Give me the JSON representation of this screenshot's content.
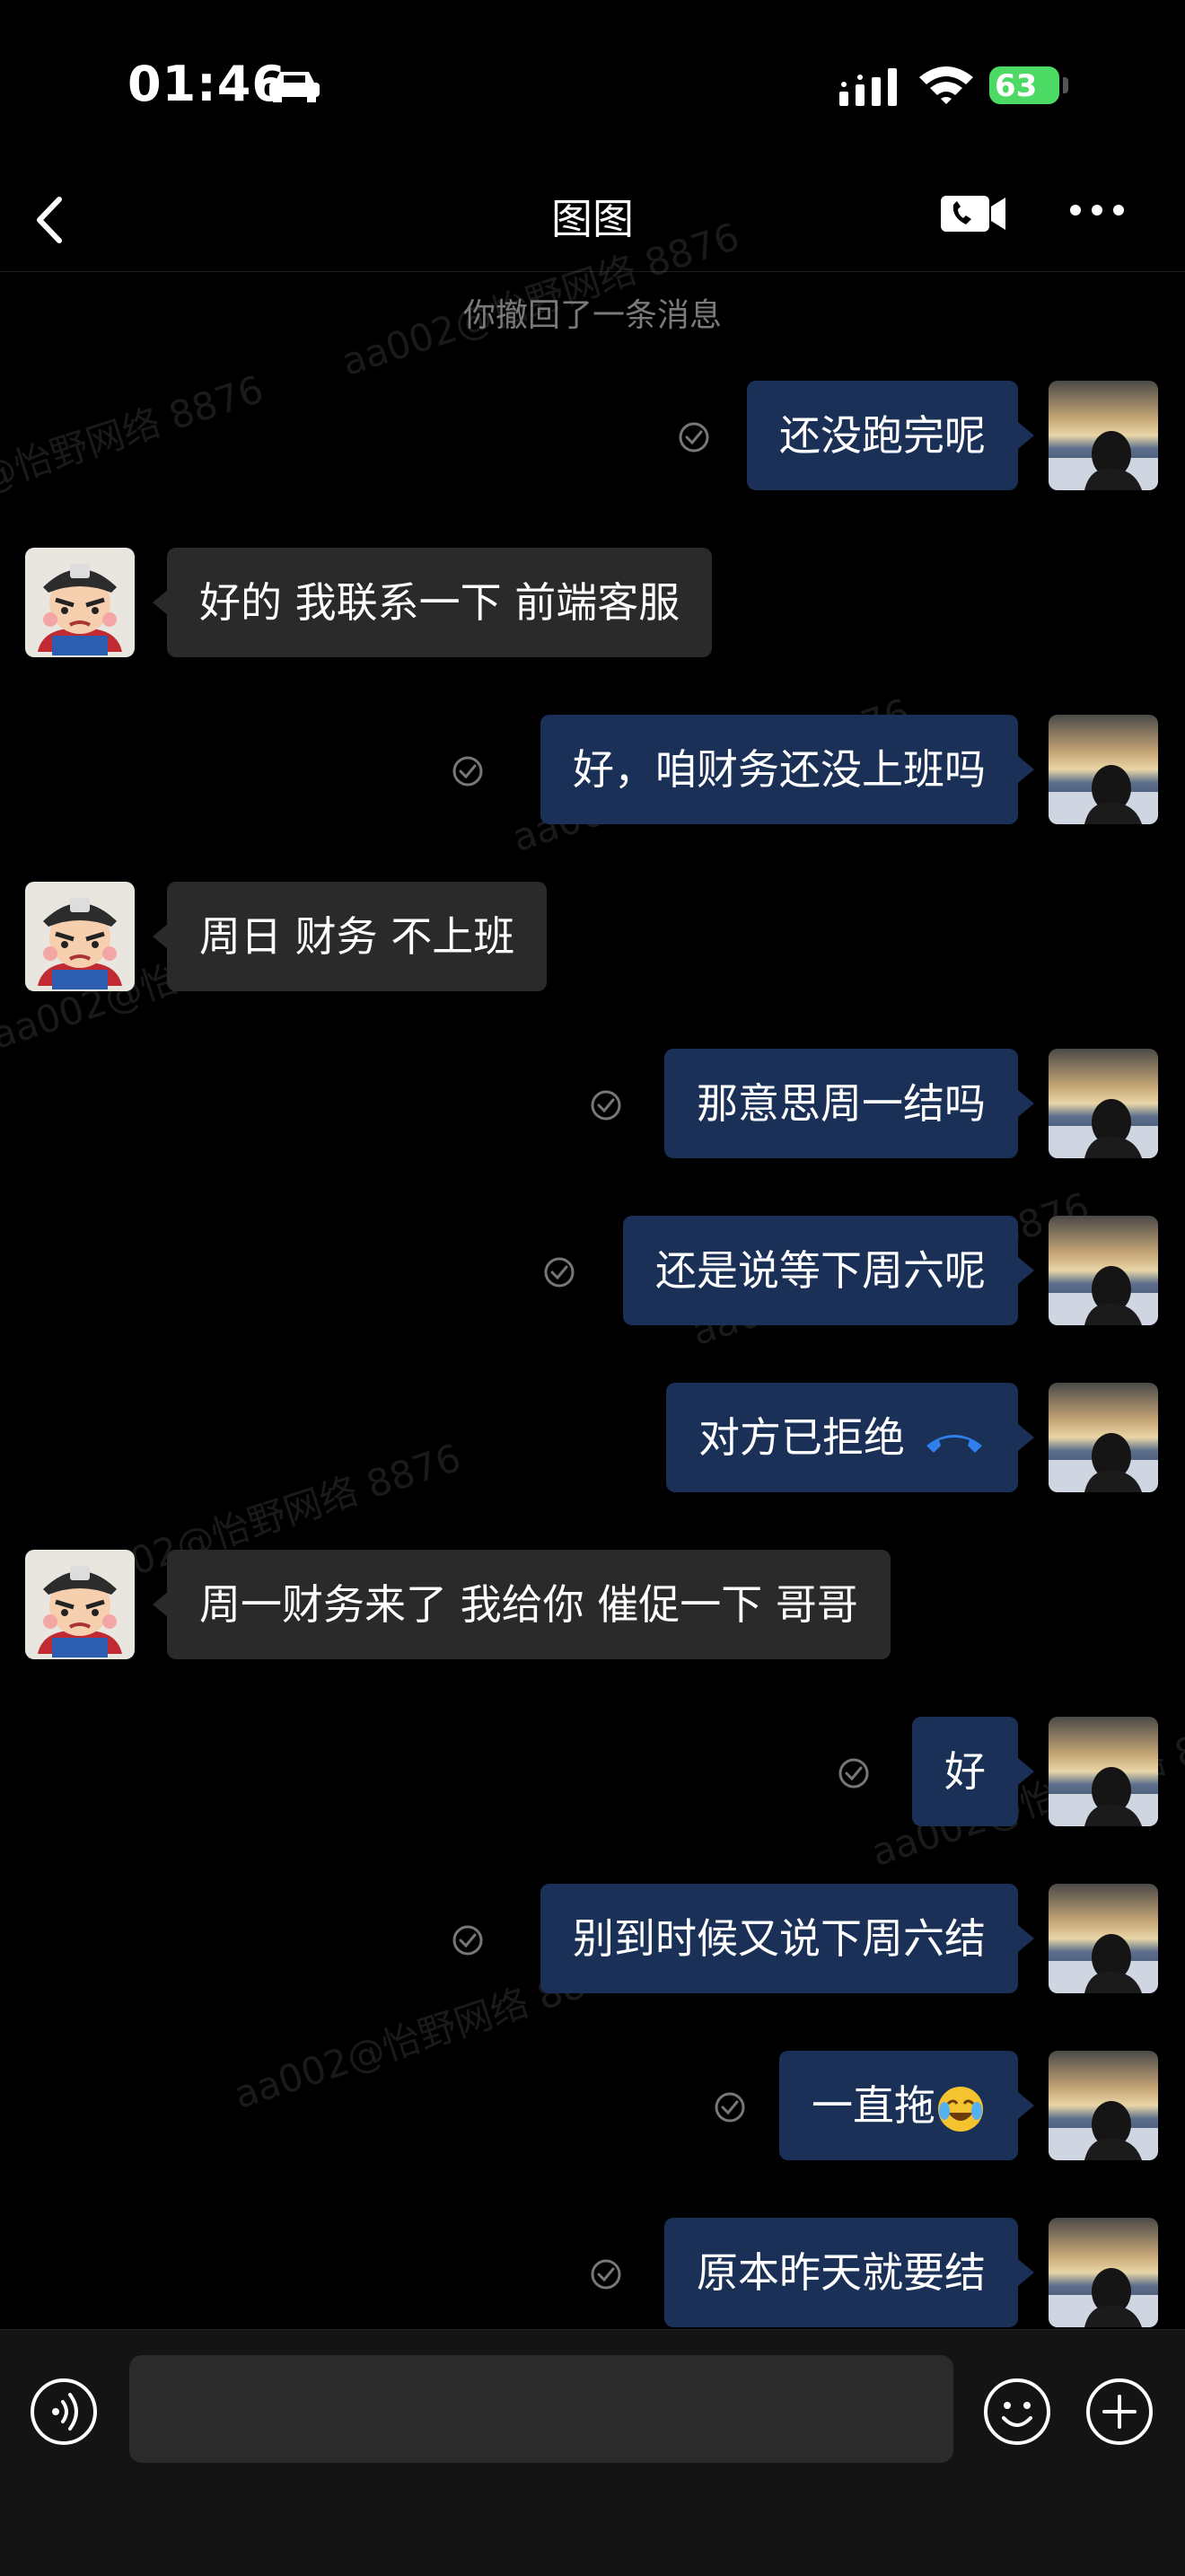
{
  "status_bar": {
    "time": "01:46",
    "battery": "63"
  },
  "header": {
    "title": "图图"
  },
  "recall_notice": "你撤回了一条消息",
  "messages": [
    {
      "sender": "me",
      "text": "还没跑完呢"
    },
    {
      "sender": "other",
      "text": "好的  我联系一下 前端客服"
    },
    {
      "sender": "me",
      "text": "好，咱财务还没上班吗"
    },
    {
      "sender": "other",
      "text": "周日 财务 不上班"
    },
    {
      "sender": "me",
      "text": "那意思周一结吗"
    },
    {
      "sender": "me",
      "text": "还是说等下周六呢"
    },
    {
      "sender": "me",
      "text": "对方已拒绝"
    },
    {
      "sender": "other",
      "text": "周一财务来了  我给你 催促一下 哥哥"
    },
    {
      "sender": "me",
      "text": "好"
    },
    {
      "sender": "me",
      "text": "别到时候又说下周六结"
    },
    {
      "sender": "me",
      "text": "一直拖"
    },
    {
      "sender": "me",
      "text": "原本昨天就要结"
    }
  ],
  "watermark": "aa002@怡野网络 8876",
  "input": {
    "placeholder": ""
  },
  "colors": {
    "my_bubble": "#1a3057",
    "other_bubble": "#2a2a2a",
    "call_icon": "#2f80ed"
  }
}
